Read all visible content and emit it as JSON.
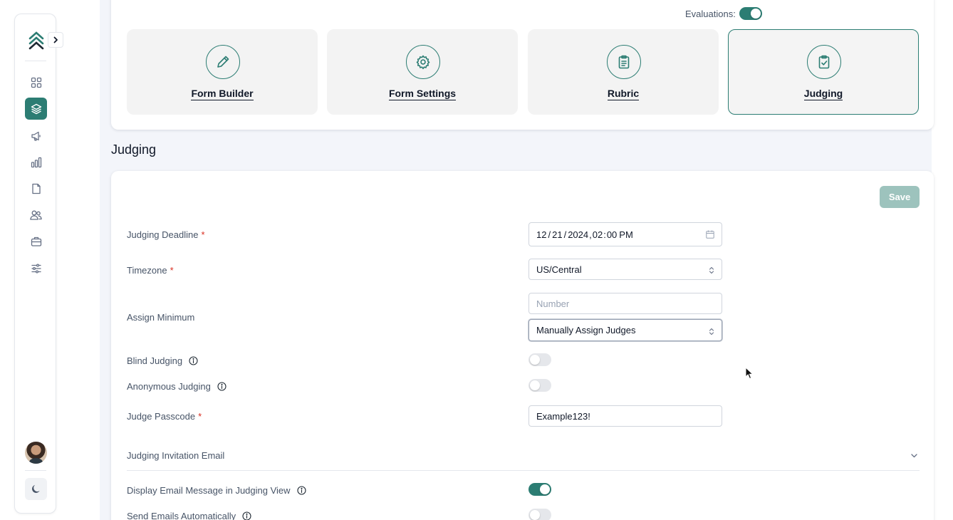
{
  "colors": {
    "accent": "#2c7d73",
    "save_disabled": "#9dc3bd",
    "required": "#d92d20"
  },
  "sidebar": {
    "expand_icon": "chevron-right-icon",
    "items": [
      {
        "name": "dashboard-icon"
      },
      {
        "name": "layers-icon",
        "active": true
      },
      {
        "name": "megaphone-icon"
      },
      {
        "name": "bar-chart-icon"
      },
      {
        "name": "document-icon"
      },
      {
        "name": "users-icon"
      },
      {
        "name": "briefcase-icon"
      },
      {
        "name": "sliders-icon"
      }
    ],
    "theme_icon": "moon-icon"
  },
  "header": {
    "evaluations_label": "Evaluations:",
    "evaluations_on": true
  },
  "tiles": [
    {
      "label": "Form Builder",
      "icon": "pencil-icon",
      "active": false
    },
    {
      "label": "Form Settings",
      "icon": "gear-icon",
      "active": false
    },
    {
      "label": "Rubric",
      "icon": "clipboard-list-icon",
      "active": false
    },
    {
      "label": "Judging",
      "icon": "clipboard-check-icon",
      "active": true
    }
  ],
  "section_title": "Judging",
  "form": {
    "save_label": "Save",
    "deadline": {
      "label": "Judging Deadline",
      "required_mark": "*",
      "month": "12",
      "day": "21",
      "year": "2024",
      "hour": "02",
      "minute": "00",
      "ampm": "PM",
      "sep_slash": "/",
      "sep_comma": ",",
      "sep_colon": ":"
    },
    "timezone": {
      "label": "Timezone",
      "required_mark": "*",
      "value": "US/Central"
    },
    "assign_minimum": {
      "label": "Assign Minimum",
      "placeholder": "Number",
      "mode": "Manually Assign Judges"
    },
    "blind_judging": {
      "label": "Blind Judging",
      "on": false
    },
    "anonymous_judging": {
      "label": "Anonymous Judging",
      "on": false
    },
    "judge_passcode": {
      "label": "Judge Passcode",
      "required_mark": "*",
      "value": "Example123!"
    },
    "invitation_email": {
      "label": "Judging Invitation Email"
    },
    "display_email": {
      "label": "Display Email Message in Judging View",
      "on": true
    },
    "send_emails": {
      "label": "Send Emails Automatically",
      "on": false
    }
  }
}
